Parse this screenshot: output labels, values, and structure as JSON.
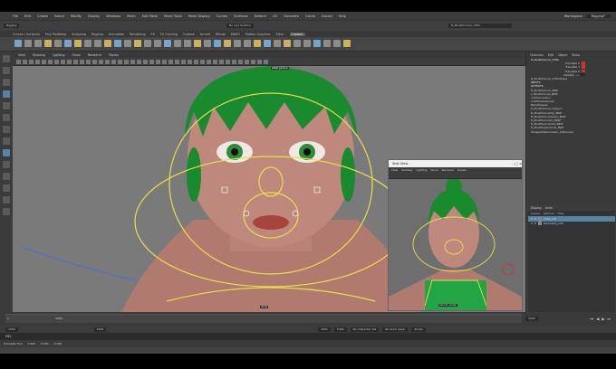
{
  "menubar": {
    "items": [
      "File",
      "Edit",
      "Create",
      "Select",
      "Modify",
      "Display",
      "Windows",
      "Mesh",
      "Edit Mesh",
      "Mesh Tools",
      "Mesh Display",
      "Curves",
      "Surfaces",
      "Deform",
      "UV",
      "Generate",
      "Cache",
      "Arnold",
      "Help"
    ],
    "workspace_label": "Workspace:",
    "workspace_value": "Rigging*"
  },
  "shelf_tabs": [
    "Curves / Surfaces",
    "Poly Modeling",
    "Sculpting",
    "Rigging",
    "Animation",
    "Rendering",
    "FX",
    "FX Caching",
    "Custom",
    "Arnold",
    "Bifrost",
    "MASH",
    "Motion Graphics",
    "XGen",
    "Custom"
  ],
  "active_shelf_tab": "Custom",
  "status_line": {
    "mode": "Rigging",
    "selected_object": "R_MouthCorner_CTRL",
    "live_surface": "No Live Surface"
  },
  "viewport_menu": [
    "View",
    "Shading",
    "Lighting",
    "Show",
    "Renderer",
    "Panels"
  ],
  "viewport_hud": {
    "camera_label": "persp",
    "color_space": "sRGB gamma"
  },
  "channel_box": {
    "menu": [
      "Channels",
      "Edit",
      "Object",
      "Show"
    ],
    "object": "R_MouthCorner_CTRL",
    "attributes": [
      {
        "name": "Translate X",
        "value": ""
      },
      {
        "name": "Translate Y",
        "value": ""
      },
      {
        "name": "Translate Z",
        "value": ""
      },
      {
        "name": "Visibility",
        "value": "on"
      }
    ],
    "shape": "R_MouthCorner_CTRLShape",
    "inputs_header": "INPUTS",
    "outputs_header": "OUTPUTS",
    "outputs": [
      "R_MouthCorner_BWP",
      "L_MouthCorner_BWP",
      "unitConversion",
      "multDoubleLinear",
      "BlendShapes",
      "R_MouthCorner_Lipsync",
      "R_MouthCornerUp_BWP",
      "R_MouthCornerDown_BWP",
      "R_MouthCornerIn_BWP",
      "R_MouthCornerOut_BWP",
      "R_MouthOpenSmile_BWP",
      "WrapperDeformation_Influences"
    ]
  },
  "layers": {
    "tabs": [
      "Display",
      "Anim"
    ],
    "menu": [
      "Layers",
      "Options",
      "Help"
    ],
    "rows": [
      {
        "label": "CTRL_LYR",
        "selected": true
      },
      {
        "label": "Geometry_LYR",
        "selected": false
      }
    ]
  },
  "float_panel": {
    "title": "Side View",
    "menu": [
      "View",
      "Shading",
      "Lighting",
      "Show",
      "Renderer",
      "Panels"
    ],
    "camera_label": "second_screen"
  },
  "timeslider": {
    "start": "1",
    "end": "1000",
    "current": "1000",
    "range_start": "1000",
    "range_end": "1000",
    "anim_start": "1001",
    "anim_end": "5400",
    "character_set": "No Character Set",
    "anim_layer": "No Anim Layer",
    "fps": "24 fps"
  },
  "mel_label": "MEL",
  "help_line": [
    "Translate Tool",
    "0.000",
    "0.000",
    "0.000"
  ],
  "colors": {
    "menubar": "#3c3c3c",
    "viewport_bg": "#7a7a7a",
    "hair": "#1a8a2e",
    "skin": "#b98478",
    "control_yellow": "#e8e04a",
    "accent_blue": "#5285a6"
  }
}
